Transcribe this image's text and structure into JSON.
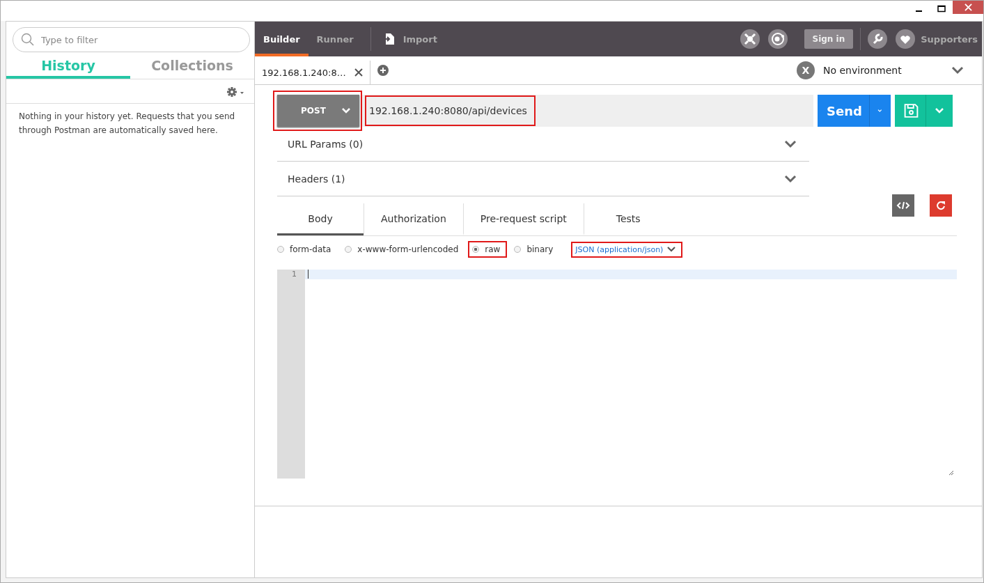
{
  "sidebar": {
    "search": {
      "placeholder": "Type to filter"
    },
    "tabs": [
      {
        "label": "History",
        "selected": true
      },
      {
        "label": "Collections",
        "selected": false
      }
    ],
    "empty_message": "Nothing in your history yet. Requests that you send through Postman are automatically saved here."
  },
  "toolbar": {
    "tabs": [
      {
        "label": "Builder",
        "selected": true
      },
      {
        "label": "Runner",
        "selected": false
      }
    ],
    "import": "Import",
    "sign_in": "Sign in",
    "supporters": "Supporters"
  },
  "request_tabs": [
    {
      "label": "192.168.1.240:8…"
    }
  ],
  "environment": {
    "badge": "X",
    "label": "No environment"
  },
  "request": {
    "method": "POST",
    "method_highlighted": true,
    "url": "192.168.1.240:8080/api/devices",
    "url_highlighted": true,
    "send": "Send"
  },
  "sections": [
    {
      "label": "URL Params (0)"
    },
    {
      "label": "Headers (1)"
    }
  ],
  "body_tabs": [
    {
      "label": "Body",
      "selected": true
    },
    {
      "label": "Authorization",
      "selected": false
    },
    {
      "label": "Pre-request script",
      "selected": false
    },
    {
      "label": "Tests",
      "selected": false
    }
  ],
  "body_modes": [
    {
      "label": "form-data",
      "selected": false,
      "highlighted": false
    },
    {
      "label": "x-www-form-urlencoded",
      "selected": false,
      "highlighted": false
    },
    {
      "label": "raw",
      "selected": true,
      "highlighted": true
    },
    {
      "label": "binary",
      "selected": false,
      "highlighted": false
    }
  ],
  "content_type": {
    "label": "JSON (application/json)",
    "highlighted": true
  },
  "editor": {
    "line_numbers": [
      "1"
    ]
  }
}
